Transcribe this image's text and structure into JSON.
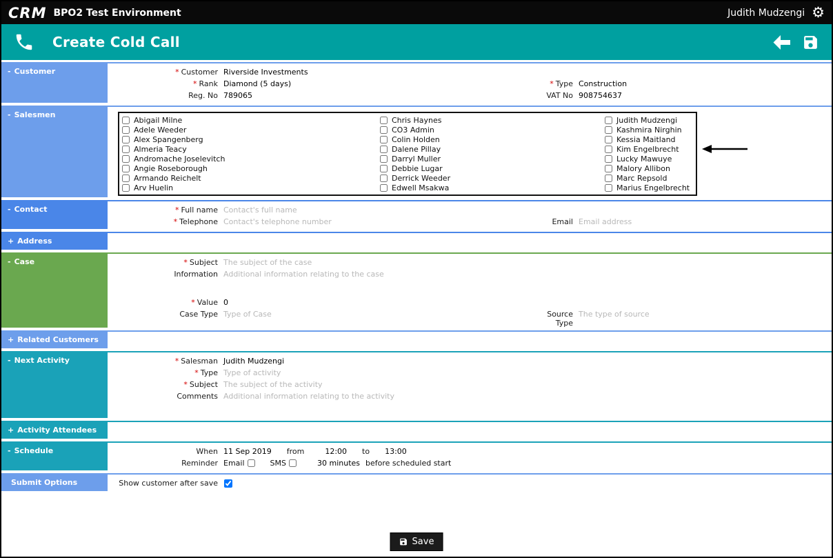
{
  "required_mark": "*",
  "topbar": {
    "logo": "CRM",
    "environment": "BPO2 Test Environment",
    "user": "Judith Mudzengi"
  },
  "header": {
    "title": "Create Cold Call"
  },
  "colors": {
    "topbar": "#0A0A0A",
    "header_teal": "#00A0A0",
    "light_blue": "#6D9EEB",
    "blue": "#4A86E8",
    "green": "#6AA84F",
    "section_teal": "#1AA2B8"
  },
  "sections": {
    "customer": {
      "toggle": "-",
      "label": "Customer",
      "customer_label": "Customer",
      "customer_value": "Riverside Investments",
      "rank_label": "Rank",
      "rank_value": "Diamond (5 days)",
      "type_label": "Type",
      "type_value": "Construction",
      "regno_label": "Reg. No",
      "regno_value": "789065",
      "vat_label": "VAT No",
      "vat_value": "908754637"
    },
    "salesmen": {
      "toggle": "-",
      "label": "Salesmen",
      "columns": [
        [
          "Abigail Milne",
          "Adele Weeder",
          "Alex Spangenberg",
          "Almeria Teacy",
          "Andromache Joselevitch",
          "Angie Roseborough",
          "Armando Reichelt",
          "Arv Huelin"
        ],
        [
          "Chris Haynes",
          "CO3 Admin",
          "Colin Holden",
          "Dalene Pillay",
          "Darryl Muller",
          "Debbie Lugar",
          "Derrick Weeder",
          "Edwell Msakwa"
        ],
        [
          "Judith Mudzengi",
          "Kashmira Nirghin",
          "Kessia Maitland",
          "Kim Engelbrecht",
          "Lucky Mawuye",
          "Malory Allibon",
          "Marc Repsold",
          "Marius Engelbrecht"
        ]
      ]
    },
    "contact": {
      "toggle": "-",
      "label": "Contact",
      "fullname_label": "Full name",
      "fullname_placeholder": "Contact's full name",
      "telephone_label": "Telephone",
      "telephone_placeholder": "Contact's telephone number",
      "email_label": "Email",
      "email_placeholder": "Email address"
    },
    "address": {
      "toggle": "+",
      "label": "Address"
    },
    "case": {
      "toggle": "-",
      "label": "Case",
      "subject_label": "Subject",
      "subject_placeholder": "The subject of the case",
      "information_label": "Information",
      "information_placeholder": "Additional information relating to the case",
      "value_label": "Value",
      "value_value": "0",
      "casetype_label": "Case Type",
      "casetype_placeholder": "Type of Case",
      "sourcetype_label": "Source Type",
      "sourcetype_placeholder": "The type of source"
    },
    "related_customers": {
      "toggle": "+",
      "label": "Related Customers"
    },
    "next_activity": {
      "toggle": "-",
      "label": "Next Activity",
      "salesman_label": "Salesman",
      "salesman_value": "Judith Mudzengi",
      "type_label": "Type",
      "type_placeholder": "Type of activity",
      "subject_label": "Subject",
      "subject_placeholder": "The subject of the activity",
      "comments_label": "Comments",
      "comments_placeholder": "Additional information relating to the activity"
    },
    "activity_attendees": {
      "toggle": "+",
      "label": "Activity Attendees"
    },
    "schedule": {
      "toggle": "-",
      "label": "Schedule",
      "when_label": "When",
      "when_value": "11 Sep 2019",
      "from_label": "from",
      "from_value": "12:00",
      "to_label": "to",
      "to_value": "13:00",
      "reminder_label": "Reminder",
      "email_label": "Email",
      "sms_label": "SMS",
      "minutes_value": "30 minutes",
      "before_label": "before scheduled start"
    },
    "submit_options": {
      "toggle": "",
      "label": "Submit Options",
      "show_customer_label": "Show customer after save",
      "show_customer_checked": true
    }
  },
  "footer": {
    "save_label": "Save"
  }
}
